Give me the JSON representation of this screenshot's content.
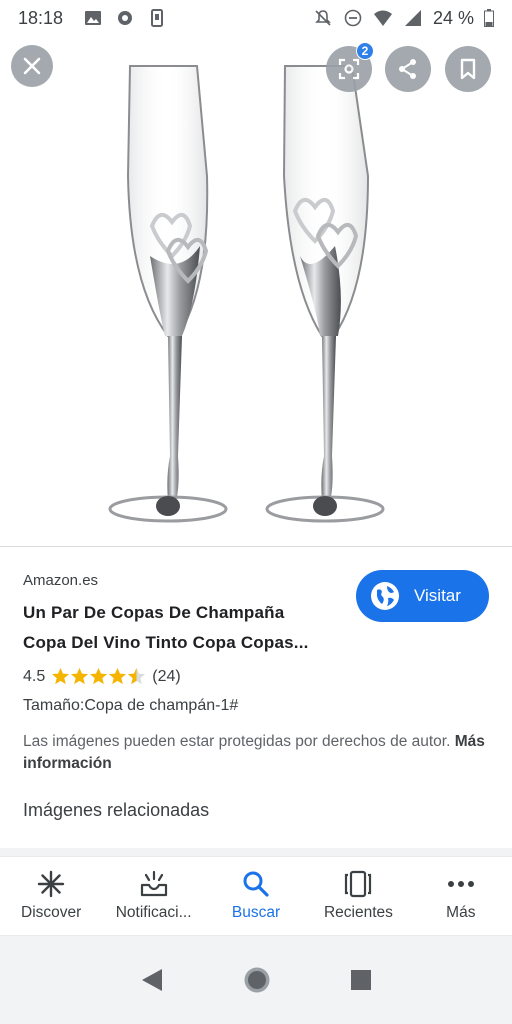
{
  "status_bar": {
    "time": "18:18",
    "battery": "24 %"
  },
  "image_viewer": {
    "lens_badge_count": "2"
  },
  "result": {
    "source": "Amazon.es",
    "title_line1": "Un Par De Copas De Champaña",
    "title_line2": "Copa Del Vino Tinto Copa Copas...",
    "rating_value": "4.5",
    "rating_stars": 4.5,
    "rating_count": "(24)",
    "size": "Tamaño:Copa de champán-1#",
    "notice_text": "Las imágenes pueden estar protegidas por derechos de autor.",
    "notice_link": "Más información",
    "visit_label": "Visitar"
  },
  "related_heading": "Imágenes relacionadas",
  "bottom_nav": {
    "items": [
      {
        "label": "Discover",
        "icon": "asterisk-icon"
      },
      {
        "label": "Notificaci...",
        "icon": "inbox-bell-icon"
      },
      {
        "label": "Buscar",
        "icon": "search-icon"
      },
      {
        "label": "Recientes",
        "icon": "recents-icon"
      },
      {
        "label": "Más",
        "icon": "more-dots-icon"
      }
    ],
    "active": "Buscar"
  },
  "colors": {
    "accent": "#1a73e8",
    "star": "#f4b400"
  }
}
